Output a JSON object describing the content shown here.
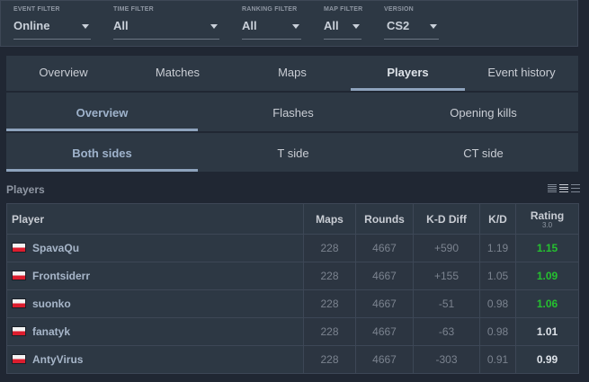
{
  "filters": [
    {
      "label": "EVENT FILTER",
      "value": "Online"
    },
    {
      "label": "TIME FILTER",
      "value": "All"
    },
    {
      "label": "RANKING FILTER",
      "value": "All"
    },
    {
      "label": "MAP FILTER",
      "value": "All"
    },
    {
      "label": "VERSION",
      "value": "CS2"
    }
  ],
  "main_tabs": [
    {
      "label": "Overview"
    },
    {
      "label": "Matches"
    },
    {
      "label": "Maps"
    },
    {
      "label": "Players",
      "active": true
    },
    {
      "label": "Event history"
    }
  ],
  "sub_tabs": [
    {
      "label": "Overview",
      "active": true
    },
    {
      "label": "Flashes"
    },
    {
      "label": "Opening kills"
    }
  ],
  "side_tabs": [
    {
      "label": "Both sides",
      "active": true
    },
    {
      "label": "T side"
    },
    {
      "label": "CT side"
    }
  ],
  "section": {
    "title": "Players"
  },
  "view_icons": [
    "compact-list-icon",
    "list-icon",
    "expanded-list-icon"
  ],
  "table": {
    "headers": {
      "player": "Player",
      "maps": "Maps",
      "rounds": "Rounds",
      "kd_diff": "K-D Diff",
      "kd": "K/D",
      "rating": "Rating",
      "rating_version": "3.0"
    },
    "rows": [
      {
        "flag": "Poland",
        "name": "SpavaQu",
        "maps": "228",
        "rounds": "4667",
        "kd_diff": "+590",
        "kd": "1.19",
        "rating": "1.15"
      },
      {
        "flag": "Poland",
        "name": "Frontsiderr",
        "maps": "228",
        "rounds": "4667",
        "kd_diff": "+155",
        "kd": "1.05",
        "rating": "1.09"
      },
      {
        "flag": "Poland",
        "name": "suonko",
        "maps": "228",
        "rounds": "4667",
        "kd_diff": "-51",
        "kd": "0.98",
        "rating": "1.06"
      },
      {
        "flag": "Poland",
        "name": "fanatyk",
        "maps": "228",
        "rounds": "4667",
        "kd_diff": "-63",
        "kd": "0.98",
        "rating": "1.01"
      },
      {
        "flag": "Poland",
        "name": "AntyVirus",
        "maps": "228",
        "rounds": "4667",
        "kd_diff": "-303",
        "kd": "0.91",
        "rating": "0.99"
      }
    ]
  },
  "colors": {
    "positive": "#25c02f",
    "negative": "#e23b3b",
    "accent": "#8ea3bd"
  }
}
